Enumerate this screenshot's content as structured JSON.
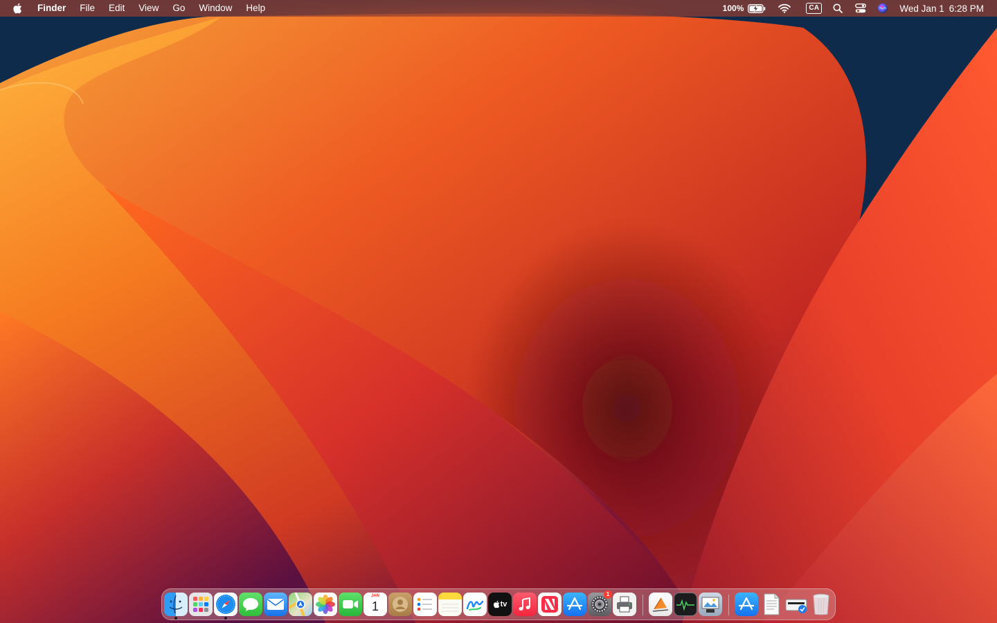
{
  "menubar": {
    "app_name": "Finder",
    "menus": [
      "File",
      "Edit",
      "View",
      "Go",
      "Window",
      "Help"
    ],
    "battery_percent": "100%",
    "input_source": "CA",
    "date": "Wed Jan 1",
    "time": "6:28 PM"
  },
  "dock": {
    "calendar_month": "JAN",
    "calendar_day": "1",
    "tv_label": "tv",
    "settings_badge": "1",
    "apps": [
      "Finder",
      "Launchpad",
      "Safari",
      "Messages",
      "Mail",
      "Maps",
      "Photos",
      "FaceTime",
      "Calendar",
      "Contacts",
      "Reminders",
      "Notes",
      "Freeform",
      "TV",
      "Music",
      "News",
      "App Store",
      "System Settings",
      "Printer",
      "Pages",
      "Activity Monitor",
      "Preview",
      "App Store",
      "Document",
      "Printer Setup",
      "Trash"
    ]
  },
  "colors": {
    "wallpaper_orange": "#f26a22",
    "wallpaper_navy": "#0d2a4a",
    "wallpaper_magenta": "#8a1c3c"
  }
}
